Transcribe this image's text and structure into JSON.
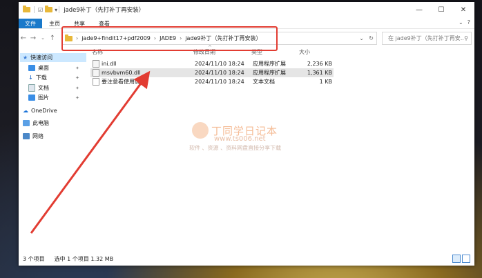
{
  "window": {
    "title": "jade9补丁（先打补丁再安装）",
    "controls": {
      "minimize": "—",
      "maximize": "☐",
      "close": "✕"
    }
  },
  "ribbon": {
    "file": "文件",
    "tabs": [
      "主页",
      "共享",
      "查看"
    ],
    "help": "?"
  },
  "address": {
    "breadcrumbs": [
      "jade9+findit17+pdf2009",
      "JADE9",
      "jade9补丁（先打补丁再安装）"
    ],
    "search_placeholder": "在 jade9补丁（先打补丁再安..."
  },
  "sidebar": {
    "items": [
      {
        "label": "快速访问",
        "icon": "star-icon",
        "pinned": false
      },
      {
        "label": "桌面",
        "icon": "desktop-icon",
        "pinned": true
      },
      {
        "label": "下载",
        "icon": "download-icon",
        "pinned": true
      },
      {
        "label": "文档",
        "icon": "document-icon",
        "pinned": true
      },
      {
        "label": "图片",
        "icon": "picture-icon",
        "pinned": true
      },
      {
        "label": "OneDrive",
        "icon": "cloud-icon",
        "pinned": false
      },
      {
        "label": "此电脑",
        "icon": "computer-icon",
        "pinned": false
      },
      {
        "label": "网络",
        "icon": "network-icon",
        "pinned": false
      }
    ]
  },
  "columns": {
    "name": "名称",
    "date": "修改日期",
    "type": "类型",
    "size": "大小"
  },
  "files": [
    {
      "name": "ini.dll",
      "date": "2024/11/10 18:24",
      "type": "应用程序扩展",
      "size": "2,236 KB"
    },
    {
      "name": "msvbvm60.dll",
      "date": "2024/11/10 18:24",
      "type": "应用程序扩展",
      "size": "1,361 KB"
    },
    {
      "name": "要注意看使用说明",
      "date": "2024/11/10 18:24",
      "type": "文本文档",
      "size": "1 KB"
    }
  ],
  "status": {
    "count": "3 个项目",
    "selected": "选中 1 个项目  1.32 MB"
  },
  "watermark": {
    "name": "丁同学日记本",
    "url": "www.ts006.net",
    "subtitle": "软件 、资源 、资料网盘直接分享下载"
  },
  "colors": {
    "accent": "#1979ca",
    "highlight_box": "#e23c32",
    "arrow": "#e23c32",
    "selection": "#cce8ff"
  }
}
